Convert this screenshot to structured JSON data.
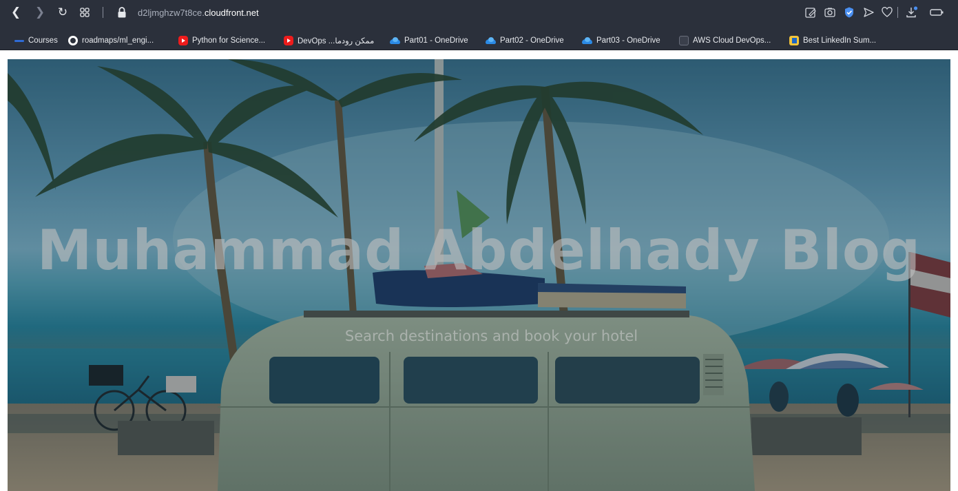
{
  "browser": {
    "nav": {
      "back_icon": "chevron-left-icon",
      "forward_icon": "chevron-right-icon",
      "reload_icon": "reload-icon",
      "tabs_icon": "grid-icon",
      "lock_icon": "lock-icon"
    },
    "url": {
      "subdomain": "d2ljmghzw7t8ce.",
      "domain": "cloudfront.net"
    },
    "toolbar_icons": [
      "edit-icon",
      "camera-icon",
      "shield-icon",
      "send-icon",
      "heart-icon",
      "download-icon",
      "battery-icon"
    ],
    "colors": {
      "chrome": "#2b303b",
      "shield_accent": "#4a8ff0",
      "download_dot": "#4a8ff0"
    }
  },
  "bookmarks": [
    {
      "label": "Courses",
      "icon": "courses-icon"
    },
    {
      "label": "roadmaps/ml_engi...",
      "icon": "github-icon"
    },
    {
      "label": "Python for Science...",
      "icon": "youtube-icon"
    },
    {
      "label": "DevOps ...ممكن رودما",
      "icon": "youtube-icon"
    },
    {
      "label": "Part01 - OneDrive",
      "icon": "onedrive-icon"
    },
    {
      "label": "Part02 - OneDrive",
      "icon": "onedrive-icon"
    },
    {
      "label": "Part03 - OneDrive",
      "icon": "onedrive-icon"
    },
    {
      "label": "AWS Cloud DevOps...",
      "icon": "document-icon"
    },
    {
      "label": "Best LinkedIn Sum...",
      "icon": "linkedin-summary-icon"
    }
  ],
  "hero": {
    "title": "Muhammad Abdelhady Blog",
    "subtitle": "Search destinations and book your hotel"
  }
}
